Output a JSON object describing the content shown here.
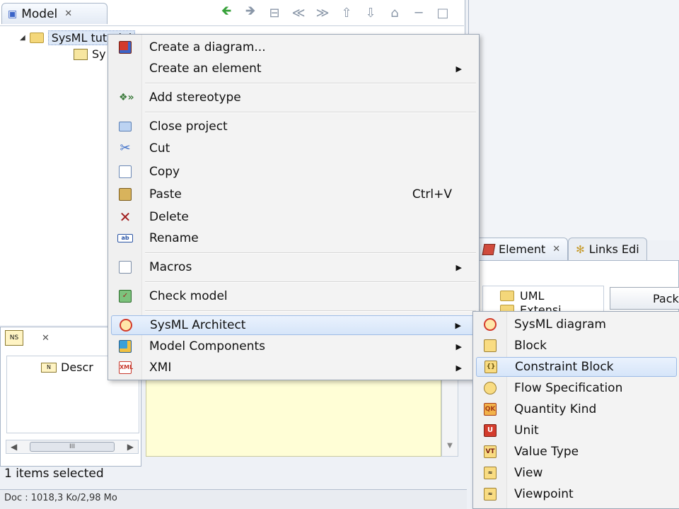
{
  "model_view": {
    "tab_title": "Model",
    "tree": {
      "root_label": "SysML tutorial",
      "child_label": "Sy"
    }
  },
  "description_view": {
    "tree_item": "Descr"
  },
  "status": {
    "selection": "1 items selected",
    "memory": "Doc : 1018,3 Ko/2,98 Mo"
  },
  "element_view": {
    "tabs": [
      {
        "label": "Element"
      },
      {
        "label": "Links Edi"
      }
    ],
    "list_item": "UML",
    "list_item_partial": "Extensi",
    "button_label": "Pack"
  },
  "context_menu": {
    "items": [
      {
        "label": "Create a diagram...",
        "icon": "diagram-cube-icon",
        "has_submenu": false
      },
      {
        "label": "Create an element",
        "icon": "",
        "has_submenu": true
      },
      {
        "label": "Add stereotype",
        "icon": "stereotype-icon",
        "has_submenu": false
      },
      {
        "label": "Close project",
        "icon": "close-project-icon",
        "has_submenu": false
      },
      {
        "label": "Cut",
        "icon": "scissors-icon",
        "has_submenu": false
      },
      {
        "label": "Copy",
        "icon": "copy-icon",
        "has_submenu": false
      },
      {
        "label": "Paste",
        "icon": "paste-icon",
        "shortcut": "Ctrl+V",
        "has_submenu": false
      },
      {
        "label": "Delete",
        "icon": "delete-icon",
        "has_submenu": false
      },
      {
        "label": "Rename",
        "icon": "rename-icon",
        "has_submenu": false
      },
      {
        "label": "Macros",
        "icon": "macros-icon",
        "has_submenu": true
      },
      {
        "label": "Check model",
        "icon": "check-model-icon",
        "has_submenu": false
      },
      {
        "label": "SysML Architect",
        "icon": "sysml-icon",
        "has_submenu": true,
        "highlighted": true
      },
      {
        "label": "Model Components",
        "icon": "model-components-icon",
        "has_submenu": true
      },
      {
        "label": "XMI",
        "icon": "xmi-icon",
        "has_submenu": true
      }
    ]
  },
  "sub_menu": {
    "items": [
      {
        "label": "SysML diagram",
        "icon": "sysml-diagram-icon"
      },
      {
        "label": "Block",
        "icon": "block-icon"
      },
      {
        "label": "Constraint Block",
        "icon": "constraint-block-icon",
        "highlighted": true
      },
      {
        "label": "Flow Specification",
        "icon": "flow-specification-icon"
      },
      {
        "label": "Quantity Kind",
        "icon": "quantity-kind-icon"
      },
      {
        "label": "Unit",
        "icon": "unit-icon"
      },
      {
        "label": "Value Type",
        "icon": "value-type-icon"
      },
      {
        "label": "View",
        "icon": "view-icon"
      },
      {
        "label": "Viewpoint",
        "icon": "viewpoint-icon"
      }
    ]
  },
  "colors": {
    "menu_highlight": "#d6e5f9",
    "panel_border": "#a9b6c8",
    "description_bg": "#fffed6"
  }
}
